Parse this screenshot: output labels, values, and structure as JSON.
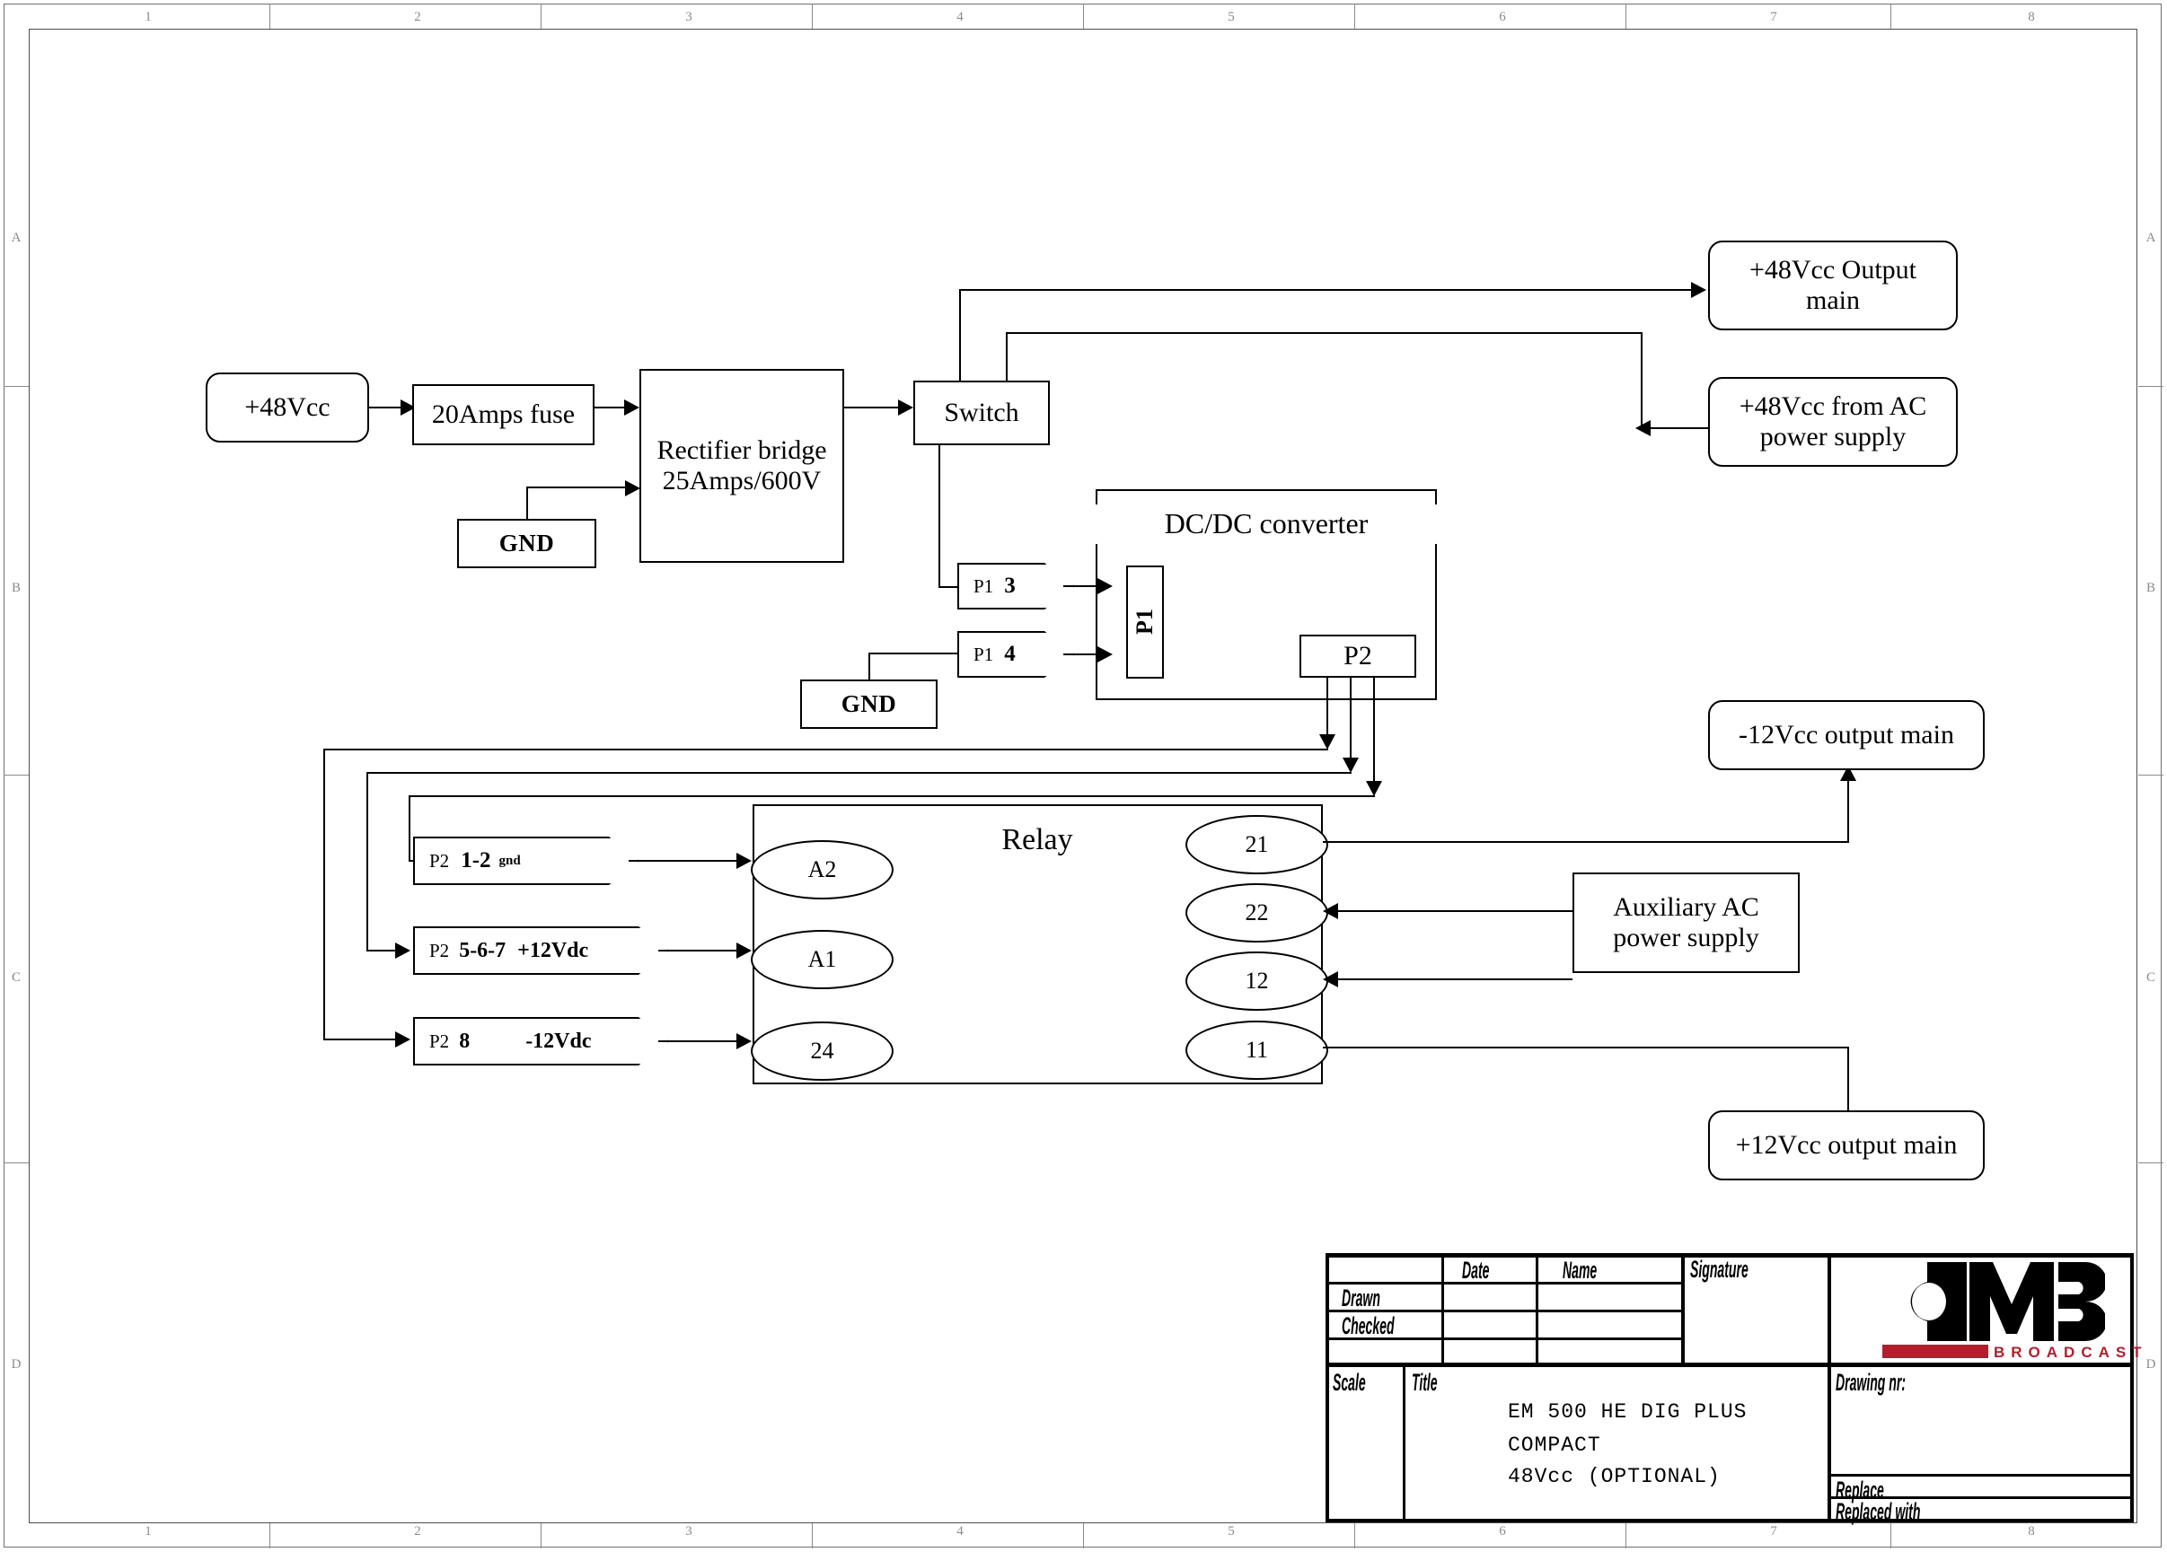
{
  "frame": {
    "zones_top": [
      "1",
      "2",
      "3",
      "4",
      "5",
      "6",
      "7",
      "8"
    ],
    "zones_bottom": [
      "1",
      "2",
      "3",
      "4",
      "5",
      "6",
      "7",
      "8"
    ],
    "zones_left": [
      "A",
      "B",
      "C",
      "D"
    ],
    "zones_right": [
      "A",
      "B",
      "C",
      "D"
    ]
  },
  "diagram": {
    "source_48v": "+48Vcc",
    "fuse": "20Amps fuse",
    "rectifier": "Rectifier bridge\n25Amps/600V",
    "rectifier_l1": "Rectifier bridge",
    "rectifier_l2": "25Amps/600V",
    "gnd_rect": "GND",
    "switch": "Switch",
    "out_48_main_l1": "+48Vcc Output",
    "out_48_main_l2": "main",
    "in_48_ac_l1": "+48Vcc from AC",
    "in_48_ac_l2": "power supply",
    "dcdc_title": "DC/DC converter",
    "dcdc_p1": "P1",
    "dcdc_p2": "P2",
    "tag_p1_3_a": "P1",
    "tag_p1_3_b": "3",
    "tag_p1_4_a": "P1",
    "tag_p1_4_b": "4",
    "gnd_p1": "GND",
    "relay_title": "Relay",
    "tag_p2_12_a": "P2",
    "tag_p2_12_b": "1-2",
    "tag_p2_12_c": "gnd",
    "tag_p2_567_a": "P2",
    "tag_p2_567_b": "5-6-7",
    "tag_p2_567_c": "+12Vdc",
    "tag_p2_8_a": "P2",
    "tag_p2_8_b": "8",
    "tag_p2_8_c": "-12Vdc",
    "term_a2": "A2",
    "term_a1": "A1",
    "term_24": "24",
    "term_21": "21",
    "term_22": "22",
    "term_12": "12",
    "term_11": "11",
    "aux_ac_l1": "Auxiliary AC",
    "aux_ac_l2": "power supply",
    "out_minus12_l1": "-12Vcc output main",
    "out_plus12_l1": "+12Vcc output main"
  },
  "title_block": {
    "col_date": "Date",
    "col_name": "Name",
    "col_signature": "Signature",
    "row_drawn": "Drawn",
    "row_checked": "Checked",
    "scale_label": "Scale",
    "scale_value": "",
    "title_label": "Title",
    "title_line1": "EM 500 HE DIG PLUS",
    "title_line2": "COMPACT",
    "title_line3": "48Vcc (OPTIONAL)",
    "drawing_nr_label": "Drawing nr:",
    "drawing_nr_value": "",
    "replace_label": "Replace",
    "replace_value": "",
    "replaced_with_label": "Replaced with",
    "replaced_with_value": "",
    "logo_text": "OMB",
    "logo_sub": "BROADCAST",
    "logo_accent": "#b51d2c"
  }
}
